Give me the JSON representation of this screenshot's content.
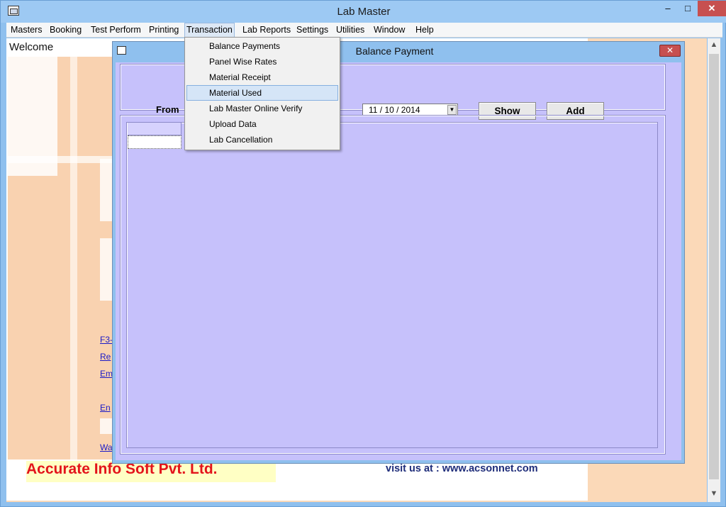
{
  "app": {
    "title": "Lab Master"
  },
  "window_buttons": {
    "minimize": "–",
    "maximize": "□",
    "close": "✕"
  },
  "menubar": [
    {
      "label": "Masters"
    },
    {
      "label": "Booking"
    },
    {
      "label": "Test Perform"
    },
    {
      "label": "Printing"
    },
    {
      "label": "Transaction"
    },
    {
      "label": "Lab Reports"
    },
    {
      "label": "Settings"
    },
    {
      "label": "Utilities"
    },
    {
      "label": "Window"
    },
    {
      "label": "Help"
    }
  ],
  "transaction_menu": {
    "items": [
      {
        "label": "Balance Payments"
      },
      {
        "label": "Panel Wise Rates"
      },
      {
        "label": "Material Receipt"
      },
      {
        "label": "Material Used"
      },
      {
        "label": "Lab Master Online Verify"
      },
      {
        "label": "Upload Data"
      },
      {
        "label": "Lab Cancellation"
      }
    ],
    "highlighted": "Material Used"
  },
  "welcome": {
    "title": "Welcome",
    "links": [
      "F3-",
      "Re",
      "Em",
      "En",
      "Wa"
    ],
    "company": "Accurate Info Soft Pvt. Ltd.",
    "visit": "visit us at : www.acsonnet.com"
  },
  "dialog": {
    "title": "Balance Payment",
    "close": "✕",
    "from_label": "From",
    "date_value": "11 / 10 / 2014",
    "show_label": "Show",
    "add_label": "Add"
  },
  "colors": {
    "accent": "#c6c1fb",
    "company_text": "#e3141b",
    "close": "#c75050"
  }
}
